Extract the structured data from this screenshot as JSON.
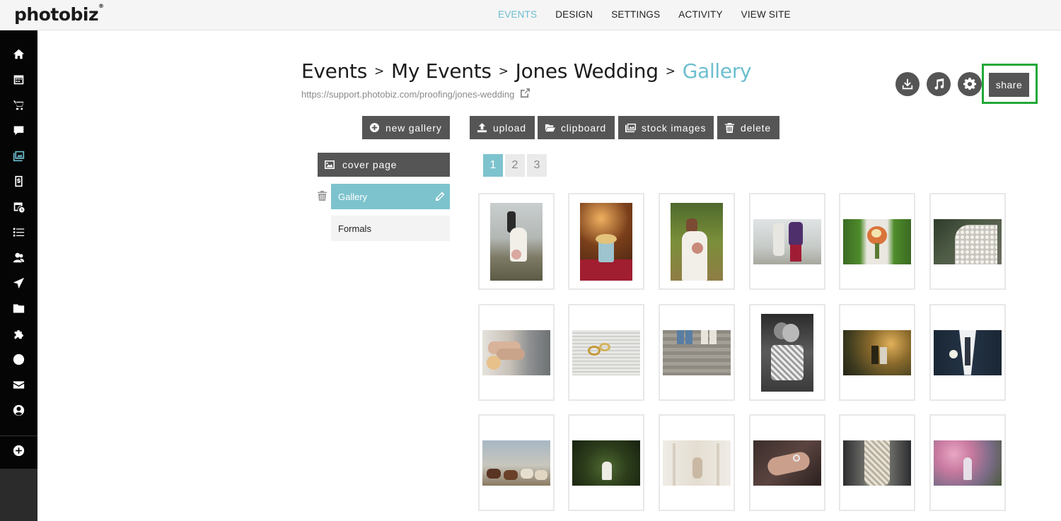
{
  "brand": {
    "name": "photobiz",
    "reg": "®"
  },
  "topnav": [
    "EVENTS",
    "DESIGN",
    "SETTINGS",
    "ACTIVITY",
    "VIEW SITE"
  ],
  "breadcrumb": {
    "items": [
      "Events",
      "My Events",
      "Jones Wedding"
    ],
    "current": "Gallery",
    "separator": ">"
  },
  "url": "https://support.photobiz.com/proofing/jones-wedding",
  "toolbar": {
    "new_gallery": "new gallery",
    "upload": "upload",
    "clipboard": "clipboard",
    "stock_images": "stock images",
    "delete": "delete"
  },
  "share_label": "share",
  "cover_page_label": "cover page",
  "galleries": [
    {
      "label": "Gallery",
      "active": true
    },
    {
      "label": "Formals",
      "active": false
    }
  ],
  "pages": [
    "1",
    "2",
    "3"
  ],
  "sidebar_icons": [
    "home-icon",
    "calendar-icon",
    "cart-icon",
    "chat-icon",
    "gallery-icon",
    "invoice-icon",
    "schedule-icon",
    "list-icon",
    "contacts-icon",
    "send-icon",
    "folder-icon",
    "plugin-icon",
    "globe-icon",
    "mail-icon",
    "account-icon",
    "add-icon"
  ],
  "colors": {
    "accent": "#6cbecf",
    "button": "#555555",
    "highlight": "#22a83a"
  }
}
